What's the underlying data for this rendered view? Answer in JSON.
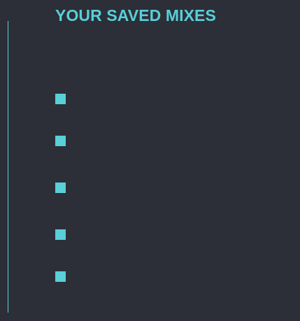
{
  "header": {
    "title": "YOUR SAVED MIXES"
  },
  "colors": {
    "background": "#2c2f38",
    "accent": "#59cfd8"
  },
  "saved_mixes": [
    {
      "label": "",
      "icon": "square-bullet-icon"
    },
    {
      "label": "",
      "icon": "square-bullet-icon"
    },
    {
      "label": "",
      "icon": "square-bullet-icon"
    },
    {
      "label": "",
      "icon": "square-bullet-icon"
    },
    {
      "label": "",
      "icon": "square-bullet-icon"
    }
  ]
}
